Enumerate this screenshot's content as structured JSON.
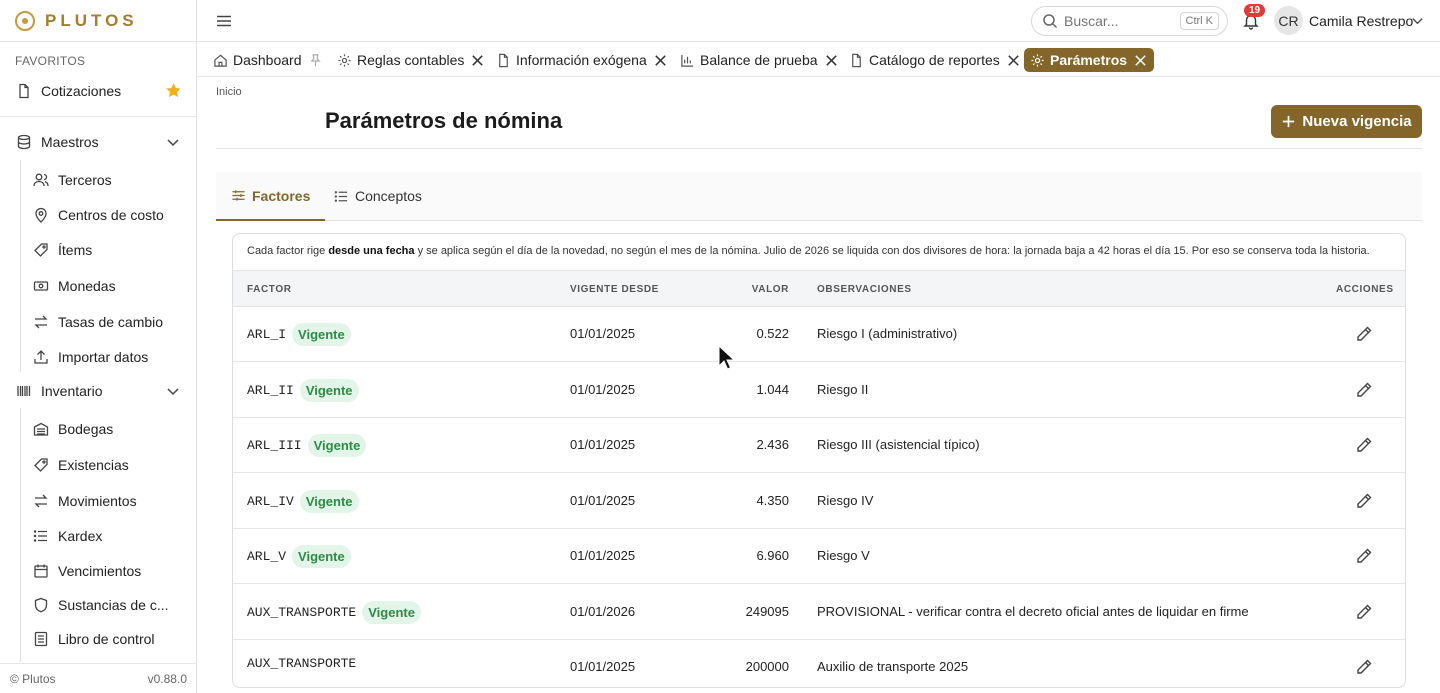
{
  "brand": "PLUTOS",
  "sidebar": {
    "favorites_title": "FAVORITOS",
    "favorites": [
      {
        "label": "Cotizaciones",
        "icon": "file-icon"
      }
    ],
    "groups": [
      {
        "label": "Maestros",
        "icon": "database-icon",
        "items": [
          {
            "label": "Terceros",
            "icon": "users-icon"
          },
          {
            "label": "Centros de costo",
            "icon": "map-pin-icon"
          },
          {
            "label": "Ítems",
            "icon": "tag-icon"
          },
          {
            "label": "Monedas",
            "icon": "banknote-icon"
          },
          {
            "label": "Tasas de cambio",
            "icon": "swap-icon"
          },
          {
            "label": "Importar datos",
            "icon": "upload-icon"
          }
        ]
      },
      {
        "label": "Inventario",
        "icon": "barcode-icon",
        "items": [
          {
            "label": "Bodegas",
            "icon": "warehouse-icon"
          },
          {
            "label": "Existencias",
            "icon": "tag-icon"
          },
          {
            "label": "Movimientos",
            "icon": "swap-icon"
          },
          {
            "label": "Kardex",
            "icon": "list-icon"
          },
          {
            "label": "Vencimientos",
            "icon": "calendar-icon"
          },
          {
            "label": "Sustancias de c...",
            "icon": "shield-icon"
          },
          {
            "label": "Libro de control",
            "icon": "book-icon"
          }
        ]
      }
    ],
    "footer_left": "© Plutos",
    "footer_right": "v0.88.0"
  },
  "topbar": {
    "search_placeholder": "Buscar...",
    "search_shortcut": "Ctrl K",
    "notifications_count": "19",
    "user_initials": "CR",
    "user_name": "Camila Restrepo"
  },
  "tabs": [
    {
      "label": "Dashboard",
      "icon": "home-icon",
      "pinned": true
    },
    {
      "label": "Reglas contables",
      "icon": "gear-icon"
    },
    {
      "label": "Información exógena",
      "icon": "file-icon"
    },
    {
      "label": "Balance de prueba",
      "icon": "bar-chart-icon"
    },
    {
      "label": "Catálogo de reportes",
      "icon": "file-icon"
    },
    {
      "label": "Parámetros",
      "icon": "gear-icon",
      "active": true
    }
  ],
  "page": {
    "breadcrumb": "Inicio",
    "title": "Parámetros de nómina",
    "new_button": "Nueva vigencia"
  },
  "subtabs": [
    {
      "label": "Factores",
      "icon": "sliders-icon",
      "active": true
    },
    {
      "label": "Conceptos",
      "icon": "list-icon"
    }
  ],
  "info": {
    "pre": "Cada factor rige ",
    "bold": "desde una fecha",
    "post": " y se aplica según el día de la novedad, no según el mes de la nómina. Julio de 2026 se liquida con dos divisores de hora: la jornada baja a 42 horas el día 15. Por eso se conserva toda la historia."
  },
  "table": {
    "headers": {
      "factor": "FACTOR",
      "date": "VIGENTE DESDE",
      "value": "VALOR",
      "obs": "OBSERVACIONES",
      "actions": "ACCIONES"
    },
    "rows": [
      {
        "factor": "ARL_I",
        "status": "Vigente",
        "date": "01/01/2025",
        "value": "0.522",
        "obs": "Riesgo I (administrativo)"
      },
      {
        "factor": "ARL_II",
        "status": "Vigente",
        "date": "01/01/2025",
        "value": "1.044",
        "obs": "Riesgo II"
      },
      {
        "factor": "ARL_III",
        "status": "Vigente",
        "date": "01/01/2025",
        "value": "2.436",
        "obs": "Riesgo III (asistencial típico)"
      },
      {
        "factor": "ARL_IV",
        "status": "Vigente",
        "date": "01/01/2025",
        "value": "4.350",
        "obs": "Riesgo IV"
      },
      {
        "factor": "ARL_V",
        "status": "Vigente",
        "date": "01/01/2025",
        "value": "6.960",
        "obs": "Riesgo V"
      },
      {
        "factor": "AUX_TRANSPORTE",
        "status": "Vigente",
        "date": "01/01/2026",
        "value": "249095",
        "obs": "PROVISIONAL - verificar contra el decreto oficial antes de liquidar en firme"
      },
      {
        "factor": "AUX_TRANSPORTE",
        "status": "",
        "date": "01/01/2025",
        "value": "200000",
        "obs": "Auxilio de transporte 2025"
      }
    ]
  },
  "colors": {
    "accent": "#85662a",
    "badge": "#e53935",
    "status_green": "#2e8b47",
    "star": "#f2b01e"
  }
}
